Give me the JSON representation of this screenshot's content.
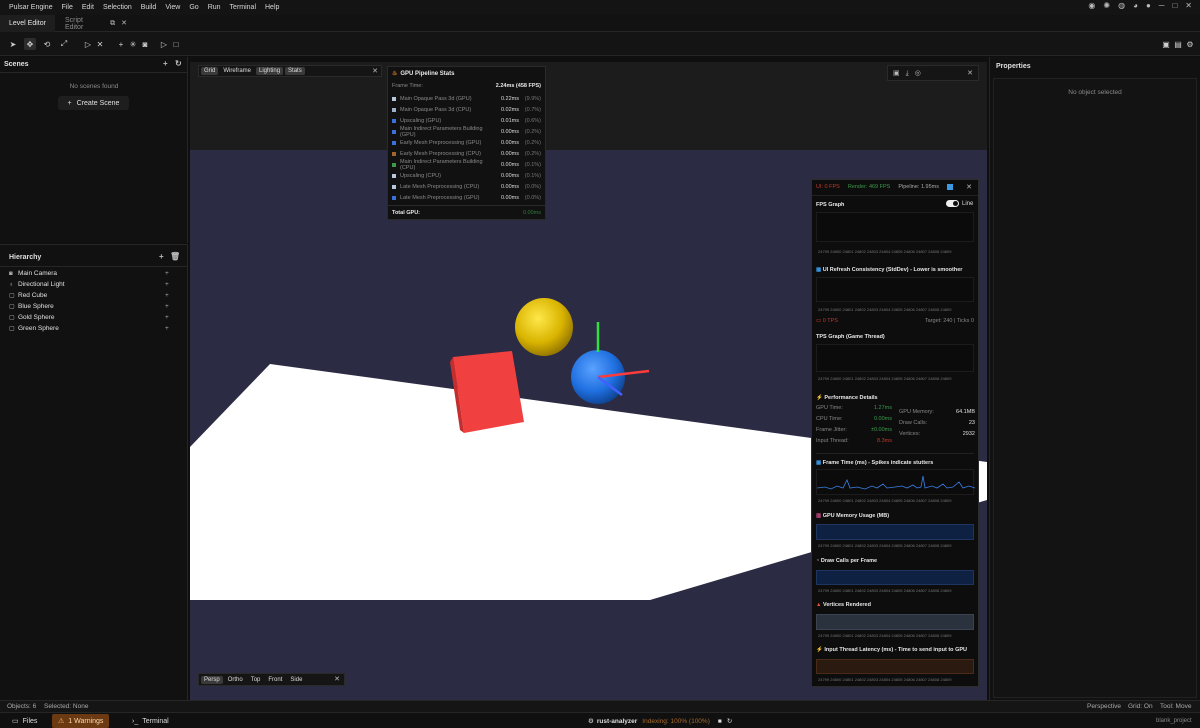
{
  "menu": {
    "app": "Pulsar Engine",
    "items": [
      "File",
      "Edit",
      "Selection",
      "Build",
      "View",
      "Go",
      "Run",
      "Terminal",
      "Help"
    ]
  },
  "tabs": {
    "level": "Level Editor",
    "script": "Script Editor"
  },
  "scenes": {
    "title": "Scenes",
    "empty": "No scenes found",
    "create": "Create Scene"
  },
  "hierarchy": {
    "title": "Hierarchy",
    "items": [
      {
        "label": "Main Camera",
        "icon": "camera-icon"
      },
      {
        "label": "Directional Light",
        "icon": "light-icon"
      },
      {
        "label": "Red Cube",
        "icon": "mesh-icon"
      },
      {
        "label": "Blue Sphere",
        "icon": "mesh-icon"
      },
      {
        "label": "Gold Sphere",
        "icon": "mesh-icon"
      },
      {
        "label": "Green Sphere",
        "icon": "mesh-icon"
      }
    ]
  },
  "viewport": {
    "top_toggles": [
      "Grid",
      "Wireframe",
      "Lighting",
      "Stats"
    ],
    "bottom_toggles": [
      "Persp",
      "Ortho",
      "Top",
      "Front",
      "Side"
    ]
  },
  "gpu_stats": {
    "title": "GPU Pipeline Stats",
    "frame_label": "Frame Time:",
    "frame_value": "2.24ms (458 FPS)",
    "rows": [
      {
        "name": "Main Opaque Pass 3d (GPU)",
        "value": "0.22ms",
        "pct": "(9.9%)",
        "color": "#b8c7dc"
      },
      {
        "name": "Main Opaque Pass 3d (CPU)",
        "value": "0.02ms",
        "pct": "(0.7%)",
        "color": "#9fb1c9"
      },
      {
        "name": "Upscaling (GPU)",
        "value": "0.01ms",
        "pct": "(0.6%)",
        "color": "#3d6fd8"
      },
      {
        "name": "Main Indirect Parameters Building (GPU)",
        "value": "0.00ms",
        "pct": "(0.2%)",
        "color": "#3d6fd8"
      },
      {
        "name": "Early Mesh Preprocessing (GPU)",
        "value": "0.00ms",
        "pct": "(0.2%)",
        "color": "#3d6fd8"
      },
      {
        "name": "Early Mesh Preprocessing (CPU)",
        "value": "0.00ms",
        "pct": "(0.2%)",
        "color": "#a1662f"
      },
      {
        "name": "Main Indirect Parameters Building (CPU)",
        "value": "0.00ms",
        "pct": "(0.1%)",
        "color": "#3a9a49"
      },
      {
        "name": "Upscaling (CPU)",
        "value": "0.00ms",
        "pct": "(0.1%)",
        "color": "#b8c7dc"
      },
      {
        "name": "Late Mesh Preprocessing (CPU)",
        "value": "0.00ms",
        "pct": "(0.0%)",
        "color": "#b8c7dc"
      },
      {
        "name": "Late Mesh Preprocessing (GPU)",
        "value": "0.00ms",
        "pct": "(0.0%)",
        "color": "#3d6fd8"
      }
    ],
    "total_label": "Total GPU:",
    "total_value": "0.00ms"
  },
  "perf": {
    "ui": "UI: 0 FPS",
    "render": "Render: 469 FPS",
    "pipeline": "Pipeline: 1.95ms",
    "fps_graph": "FPS Graph",
    "line_toggle": "Line",
    "ui_refresh": "UI Refresh Consistency (StdDev) - Lower is smoother",
    "tps": "0 TPS",
    "target": "Target: 240 | Ticks 0",
    "tps_graph": "TPS Graph (Game Thread)",
    "perf_details": "Performance Details",
    "details_left": [
      {
        "label": "GPU Time:",
        "value": "1.27ms",
        "color": "#3a9a49"
      },
      {
        "label": "CPU Time:",
        "value": "0.00ms",
        "color": "#3a9a49"
      },
      {
        "label": "Frame Jitter:",
        "value": "±0.00ms",
        "color": "#3a9a49"
      },
      {
        "label": "Input Thread:",
        "value": "8.3ms",
        "color": "#c0392b"
      }
    ],
    "details_right": [
      {
        "label": "GPU Memory:",
        "value": "64.1MB"
      },
      {
        "label": "Draw Calls:",
        "value": "23"
      },
      {
        "label": "Vertices:",
        "value": "2932"
      }
    ],
    "frame_time": "Frame Time (ms) - Spikes indicate stutters",
    "gpu_mem": "GPU Memory Usage (MB)",
    "draw_calls": "Draw Calls per Frame",
    "vertices": "Vertices Rendered",
    "input_latency": "Input Thread Latency (ms) - Time to send input to GPU",
    "axis": "24799 24800 24801 24802 24803 24804 24805 24806 24807 24808 24809"
  },
  "properties": {
    "title": "Properties",
    "empty": "No object selected"
  },
  "status": {
    "objects": "Objects: 6",
    "selected": "Selected: None",
    "projection": "Perspective",
    "grid": "Grid: On",
    "tool": "Tool: Move"
  },
  "bottom": {
    "files": "Files",
    "warnings": "1 Warnings",
    "terminal": "Terminal",
    "ra": "rust-analyzer",
    "indexing": "Indexing: 100% (100%)",
    "project": "blank_project"
  }
}
